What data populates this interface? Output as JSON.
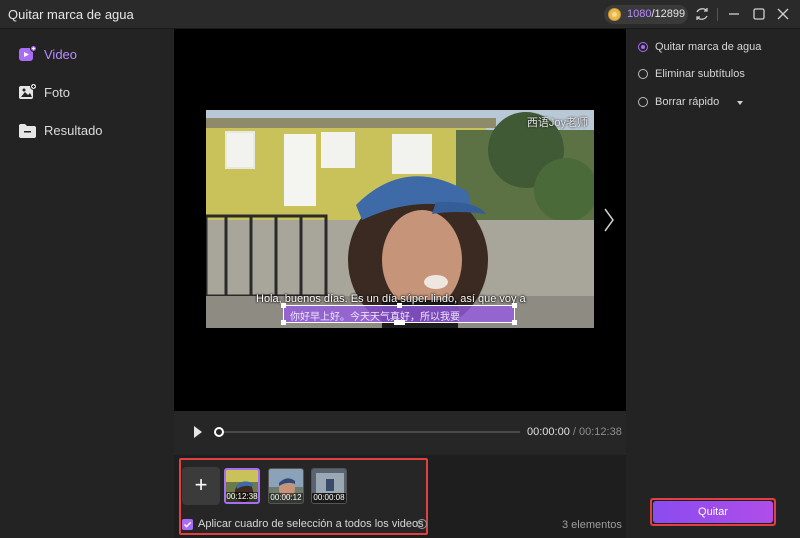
{
  "window": {
    "title": "Quitar marca de agua",
    "credits_used": "1080",
    "credits_total": "/12899"
  },
  "sidebar": {
    "items": [
      {
        "label": "Video",
        "icon": "video-icon",
        "active": true
      },
      {
        "label": "Foto",
        "icon": "photo-icon",
        "active": false
      },
      {
        "label": "Resultado",
        "icon": "folder-icon",
        "active": false
      }
    ]
  },
  "preview": {
    "watermark_text": "西语Joy老师",
    "subtitle_text": "Hola, buenos días. Es un día súper lindo, así que voy a",
    "selection_text": "你好早上好。今天天气真好，所以我要"
  },
  "player": {
    "current_time": "00:00:00",
    "total_time": " / 00:12:38",
    "progress": 0.0
  },
  "thumbnails": {
    "add_label": "+",
    "items": [
      {
        "duration": "00:12:38",
        "selected": true
      },
      {
        "duration": "00:00:12",
        "selected": false
      },
      {
        "duration": "00:00:08",
        "selected": false
      }
    ],
    "apply_label": "Aplicar cuadro de selección a todos los videos",
    "count_label": "3 elementos"
  },
  "options": {
    "items": [
      {
        "label": "Quitar marca de agua",
        "selected": true
      },
      {
        "label": "Eliminar subtítulos",
        "selected": false
      },
      {
        "label": "Borrar rápido",
        "selected": false
      }
    ],
    "action_label": "Quitar"
  },
  "colors": {
    "accent": "#a86cf5",
    "highlight_border": "#e04040"
  }
}
